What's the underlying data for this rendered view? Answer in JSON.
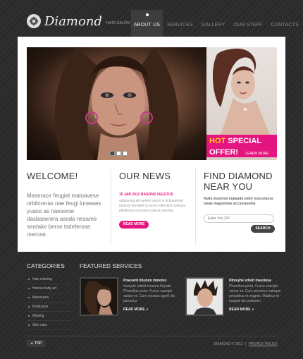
{
  "header": {
    "brand_name": "Diamond",
    "brand_tagline": "HAIR SALON",
    "nav": [
      {
        "label": "ABOUT US",
        "active": true
      },
      {
        "label": "SERVICES",
        "active": false
      },
      {
        "label": "GALLERY",
        "active": false
      },
      {
        "label": "OUR STAFF",
        "active": false
      },
      {
        "label": "CONTACTS",
        "active": false
      }
    ]
  },
  "promo": {
    "hot": "HOT",
    "special": "SPECIAL",
    "offer": "OFFER!",
    "learn_more": "LEARN MORE"
  },
  "welcome": {
    "title": "WELCOME!",
    "text": "Maserace feugiat maluavese orbiloreras nae feugi lureases yuase as naeserse dasbaserera aseda nesame serdake berse tsdeferose merose."
  },
  "news": {
    "title": "OUR NEWS",
    "date": "15 JAN 2012 BASONS VELETUS",
    "text": "adipiscing elit aenert vescit a dctioaulreal unseny henderit in lucren ellecticti sureturs efortiesos ourostos casuse drestas",
    "button": "READ MORE"
  },
  "find": {
    "title_line1": "FIND DIAMOND",
    "title_line2": "NEAR YOU",
    "text": "Nulla duismod malauda odior nonculasse meae magnomae accumasedla",
    "zip_placeholder": "Enter You ZIP",
    "search_button": "SEARCH"
  },
  "categories": {
    "title": "CATEGORIES",
    "items": [
      "Hair coloring",
      "Henna body art",
      "Manicures",
      "Pedicures",
      "Waxing",
      "Skin care"
    ]
  },
  "featured": {
    "title": "FEATURED SERVICES",
    "items": [
      {
        "title": "Praesent tibulum mlnomo",
        "text": "maeyrte edrett meuora folyade Phasellus porta. Fusce suscipit varius mi. Cum sociaos agetti dis parumus",
        "more": "READ MORE"
      },
      {
        "title": "Nimsyhe edrett mauriuya",
        "text": "Phasellus porta. Fusce suscipit varius mi. Cum sociosos natoque penatibus et magnis. Mabbus et magnis dis parturien",
        "more": "READ MORE"
      }
    ]
  },
  "footer": {
    "top_button": "TOP",
    "copyright": "DIAMOND © 2012",
    "separator": "|",
    "privacy": "PRIVACY POLICY"
  },
  "colors": {
    "accent": "#e5157f",
    "background": "#2b2b2b",
    "panel": "#ffffff"
  },
  "icons": {
    "logo": "diamond-flower-icon",
    "top_arrow": "arrow-up-icon",
    "more_arrow": "double-chevron-right-icon"
  }
}
